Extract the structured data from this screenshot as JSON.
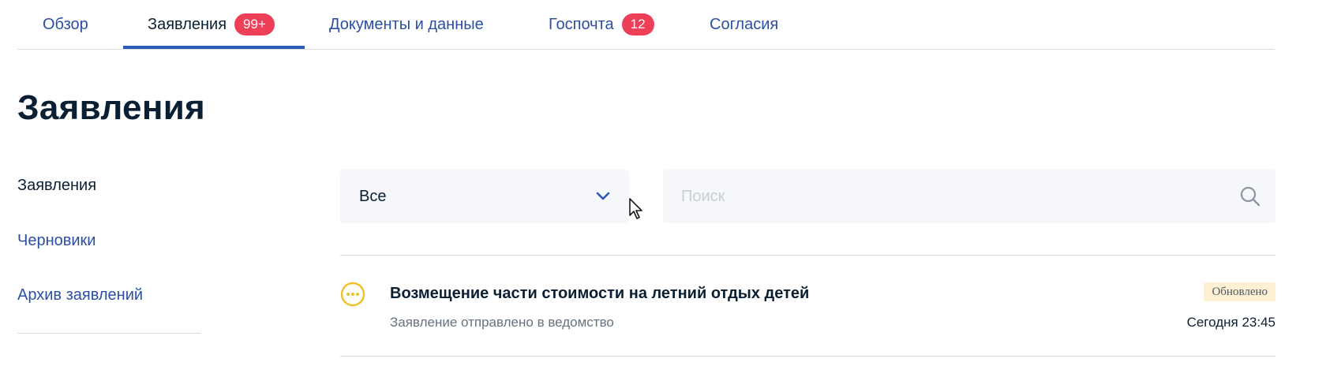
{
  "tabs": [
    {
      "label": "Обзор"
    },
    {
      "label": "Заявления",
      "badge": "99+",
      "active": true
    },
    {
      "label": "Документы и данные"
    },
    {
      "label": "Госпочта",
      "badge": "12"
    },
    {
      "label": "Согласия"
    }
  ],
  "page": {
    "title": "Заявления"
  },
  "sidenav": {
    "items": [
      {
        "label": "Заявления",
        "current": true
      },
      {
        "label": "Черновики"
      },
      {
        "label": "Архив заявлений"
      }
    ]
  },
  "filter": {
    "selected": "Все",
    "icon": "chevron-down-icon"
  },
  "search": {
    "placeholder": "Поиск",
    "value": "",
    "icon": "search-icon"
  },
  "applications": [
    {
      "title": "Возмещение части стоимости на летний отдых детей",
      "subtitle": "Заявление отправлено в ведомство",
      "badge": "Обновлено",
      "time": "Сегодня 23:45",
      "status_icon": "pending-dots-icon"
    }
  ],
  "colors": {
    "link": "#2c4fa3",
    "text": "#0b1f33",
    "active_tab_underline": "#2a5ab8",
    "counter_badge": "#ee3f58",
    "status_pending": "#f0c02b",
    "updated_badge_bg": "#fdf0d3"
  }
}
